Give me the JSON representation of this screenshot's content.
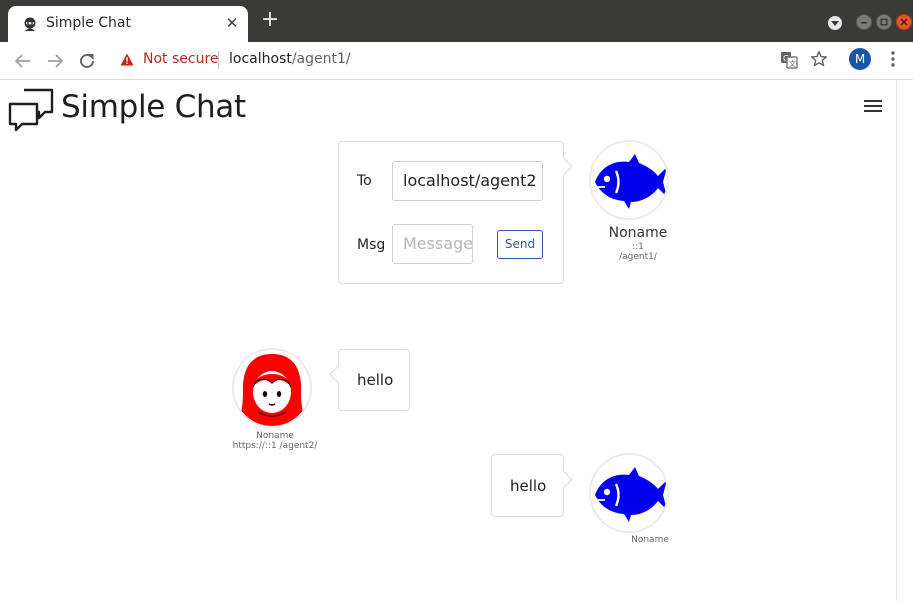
{
  "browser": {
    "tab_title": "Simple Chat",
    "new_tab_symbol": "+",
    "close_symbol": "✕",
    "security_label": "Not secure",
    "url_host": "localhost",
    "url_path": "/agent1/",
    "profile_initial": "M",
    "icons": [
      "back-icon",
      "forward-icon",
      "reload-icon",
      "warning-icon",
      "translate-icon",
      "star-icon",
      "kebab-menu-icon"
    ]
  },
  "app": {
    "title": "Simple Chat",
    "menu_icon": "hamburger-icon"
  },
  "compose": {
    "to_label": "To",
    "to_value": "localhost/agent2",
    "msg_label": "Msg",
    "msg_placeholder": "Message",
    "send_label": "Send"
  },
  "self": {
    "name": "Noname",
    "address": "::1",
    "path": "/agent1/",
    "avatar_icon": "fish-icon",
    "avatar_color": "#0000ee"
  },
  "messages": [
    {
      "direction": "incoming",
      "text": "hello",
      "sender_name": "Noname",
      "sender_address": "https://::1 /agent2/",
      "avatar_icon": "hooded-girl-icon",
      "avatar_color": "#ff0000"
    },
    {
      "direction": "outgoing",
      "text": "hello",
      "sender_name": "Noname",
      "avatar_icon": "fish-icon",
      "avatar_color": "#0000ee"
    }
  ]
}
